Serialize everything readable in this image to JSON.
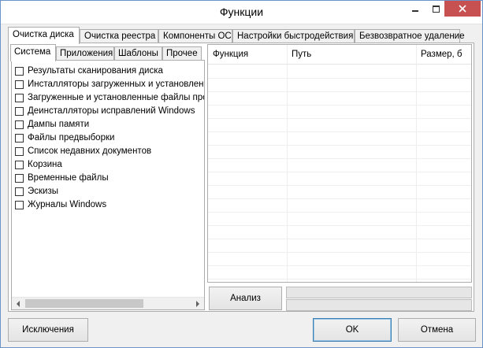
{
  "window": {
    "title": "Функции",
    "minimize_icon": "minimize-icon",
    "maximize_icon": "maximize-icon",
    "close_icon": "close-icon"
  },
  "tabs": [
    {
      "label": "Очистка диска",
      "active": true
    },
    {
      "label": "Очистка реестра",
      "active": false
    },
    {
      "label": "Компоненты ОС",
      "active": false
    },
    {
      "label": "Настройки быстродействия",
      "active": false
    },
    {
      "label": "Безвозвратное удаление",
      "active": false
    }
  ],
  "inner_tabs": [
    {
      "label": "Система",
      "active": true
    },
    {
      "label": "Приложения",
      "active": false
    },
    {
      "label": "Шаблоны",
      "active": false
    },
    {
      "label": "Прочее",
      "active": false
    }
  ],
  "items": [
    {
      "label": "Результаты сканирования диска",
      "checked": false
    },
    {
      "label": "Инсталляторы загруженных и установленны",
      "checked": false
    },
    {
      "label": "Загруженные и установленные файлы прог",
      "checked": false
    },
    {
      "label": "Деинсталляторы исправлений Windows",
      "checked": false
    },
    {
      "label": "Дампы памяти",
      "checked": false
    },
    {
      "label": "Файлы предвыборки",
      "checked": false
    },
    {
      "label": "Список недавних документов",
      "checked": false
    },
    {
      "label": "Корзина",
      "checked": false
    },
    {
      "label": "Временные файлы",
      "checked": false
    },
    {
      "label": "Эскизы",
      "checked": false
    },
    {
      "label": "Журналы Windows",
      "checked": false
    }
  ],
  "grid": {
    "columns": [
      "Функция",
      "Путь",
      "Размер, б"
    ]
  },
  "buttons": {
    "analyze": "Анализ",
    "exclusions": "Исключения",
    "ok": "OK",
    "cancel": "Отмена"
  },
  "progress": {
    "top_value": 0,
    "bottom_value": 0
  }
}
